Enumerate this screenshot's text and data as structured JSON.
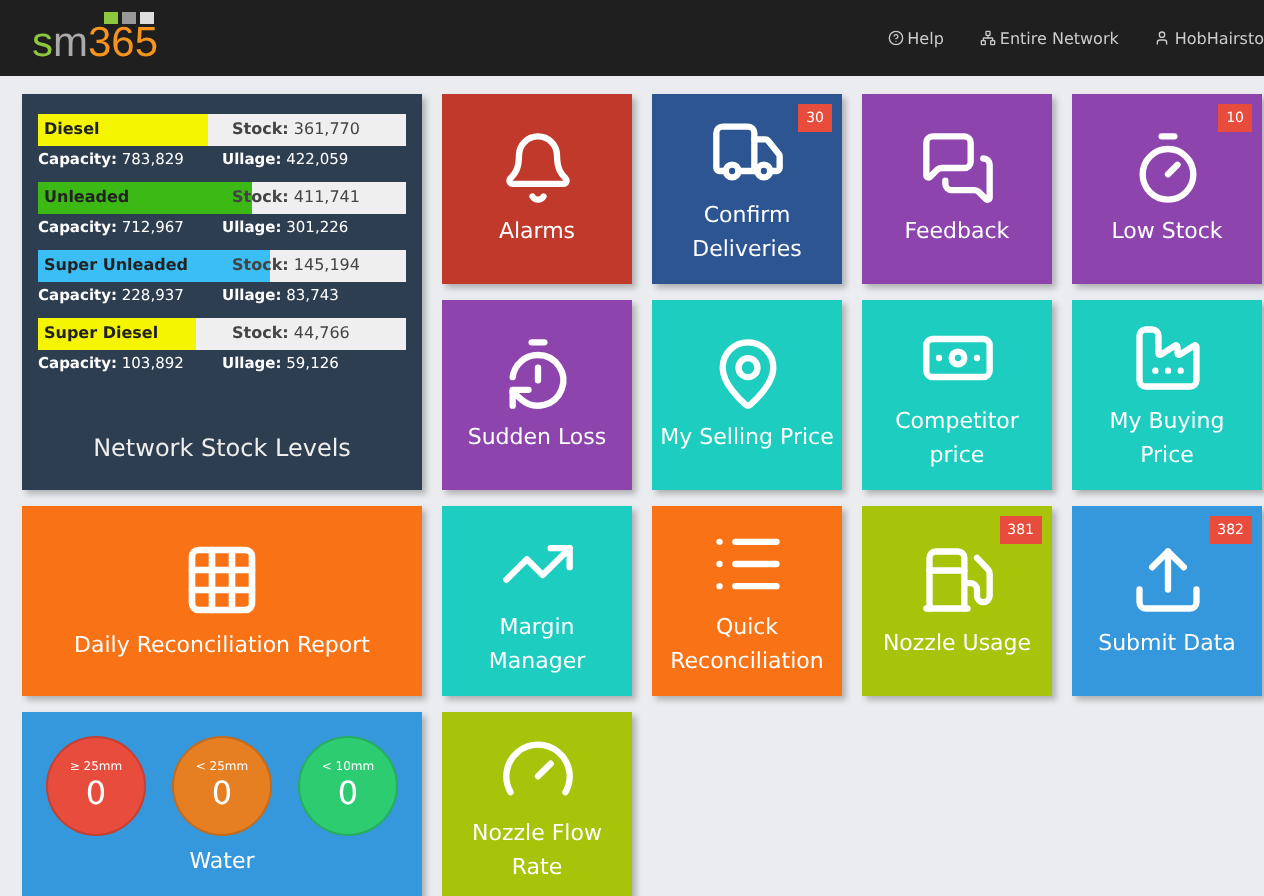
{
  "header": {
    "logo": [
      "s",
      "m",
      "365"
    ],
    "nav": [
      {
        "label": "Help"
      },
      {
        "label": "Entire Network"
      },
      {
        "label": "HobHairsto"
      }
    ]
  },
  "stock_card": {
    "title": "Network Stock Levels",
    "fuels": [
      {
        "name": "Diesel",
        "color": "#f5f500",
        "level": 0.46,
        "stock_label": "Stock:",
        "stock": "361,770",
        "capacity_label": "Capacity:",
        "capacity": "783,829",
        "ullage_label": "Ullage:",
        "ullage": "422,059"
      },
      {
        "name": "Unleaded",
        "color": "#3cb914",
        "level": 0.58,
        "stock_label": "Stock:",
        "stock": "411,741",
        "capacity_label": "Capacity:",
        "capacity": "712,967",
        "ullage_label": "Ullage:",
        "ullage": "301,226"
      },
      {
        "name": "Super Unleaded",
        "color": "#3bbdf5",
        "level": 0.63,
        "stock_label": "Stock:",
        "stock": "145,194",
        "capacity_label": "Capacity:",
        "capacity": "228,937",
        "ullage_label": "Ullage:",
        "ullage": "83,743"
      },
      {
        "name": "Super Diesel",
        "color": "#f5f500",
        "level": 0.43,
        "stock_label": "Stock:",
        "stock": "44,766",
        "capacity_label": "Capacity:",
        "capacity": "103,892",
        "ullage_label": "Ullage:",
        "ullage": "59,126"
      }
    ]
  },
  "tiles": [
    {
      "kind": "tile",
      "label": "Alarms",
      "color": "#c0392b"
    },
    {
      "kind": "tile",
      "label": "Confirm Deliveries",
      "color": "#2c5592",
      "badge": "30"
    },
    {
      "kind": "tile",
      "label": "Feedback",
      "color": "#8e44ad"
    },
    {
      "kind": "tile",
      "label": "Low Stock",
      "color": "#8e44ad",
      "badge": "10"
    },
    {
      "kind": "tile",
      "label": "Sudden Loss",
      "color": "#8e44ad"
    },
    {
      "kind": "tile",
      "label": "My Selling Price",
      "color": "#1ccdc0"
    },
    {
      "kind": "tile",
      "label": "Competitor price",
      "color": "#1ccdc0"
    },
    {
      "kind": "tile",
      "label": "My Buying Price",
      "color": "#1ccdc0"
    },
    {
      "kind": "wide",
      "label": "Daily Reconciliation Report",
      "color": "#f97316"
    },
    {
      "kind": "tile",
      "label": "Margin Manager",
      "color": "#1ccdc0"
    },
    {
      "kind": "tile",
      "label": "Quick Reconciliation",
      "color": "#f97316"
    },
    {
      "kind": "tile",
      "label": "Nozzle Usage",
      "color": "#a8c40a",
      "badge": "381"
    },
    {
      "kind": "tile",
      "label": "Submit Data",
      "color": "#3597dc",
      "badge": "382"
    },
    {
      "kind": "water",
      "label": "Water",
      "color": "#3597dc",
      "gauges": [
        {
          "label": "≥ 25mm",
          "value": "0",
          "color": "#e74c3c"
        },
        {
          "label": "< 25mm",
          "value": "0",
          "color": "#e67e22"
        },
        {
          "label": "< 10mm",
          "value": "0",
          "color": "#2ecc71"
        }
      ]
    },
    {
      "kind": "tile",
      "label": "Nozzle Flow Rate",
      "color": "#a8c40a"
    }
  ]
}
